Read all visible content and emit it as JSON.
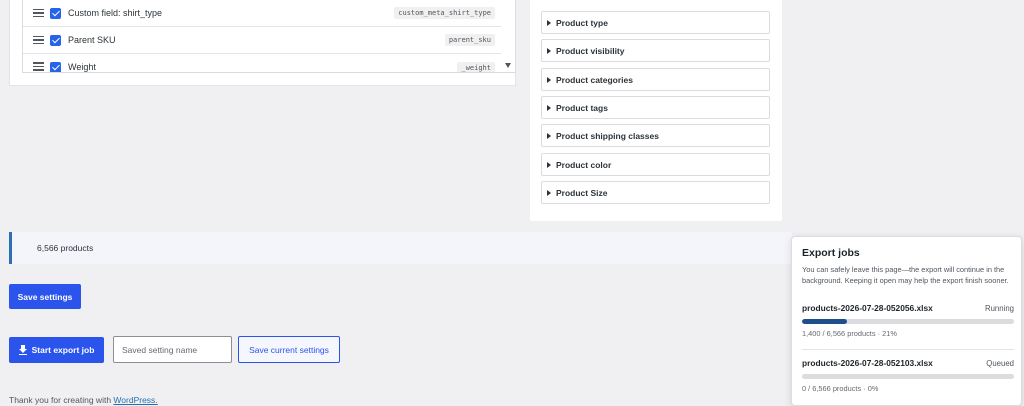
{
  "fields": [
    {
      "label": "Custom field: shirt_type",
      "key": "custom_meta_shirt_type"
    },
    {
      "label": "Parent SKU",
      "key": "parent_sku"
    },
    {
      "label": "Weight",
      "key": "_weight"
    }
  ],
  "filters": [
    "Product type",
    "Product visibility",
    "Product categories",
    "Product tags",
    "Product shipping classes",
    "Product color",
    "Product Size"
  ],
  "summary": {
    "count_text": "6,566 products"
  },
  "actions": {
    "save_settings": "Save settings",
    "start_export": "Start export job",
    "setting_name_placeholder": "Saved setting name",
    "save_current": "Save current settings"
  },
  "footer": {
    "text": "Thank you for creating with ",
    "link": "WordPress."
  },
  "export_jobs": {
    "title": "Export jobs",
    "description": "You can safely leave this page—the export will continue in the background. Keeping it open may help the export finish sooner.",
    "jobs": [
      {
        "file": "products-2026-07-28-052056.xlsx",
        "status": "Running",
        "progress_percent": 21,
        "meta": "1,400 / 6,566 products · 21%"
      },
      {
        "file": "products-2026-07-28-052103.xlsx",
        "status": "Queued",
        "progress_percent": 0,
        "meta": "0 / 6,566 products · 0%"
      }
    ]
  },
  "colors": {
    "accent": "#2b54ec",
    "progress_fill": "#1f4e8c",
    "count_bar_border": "#2d6fb5"
  }
}
